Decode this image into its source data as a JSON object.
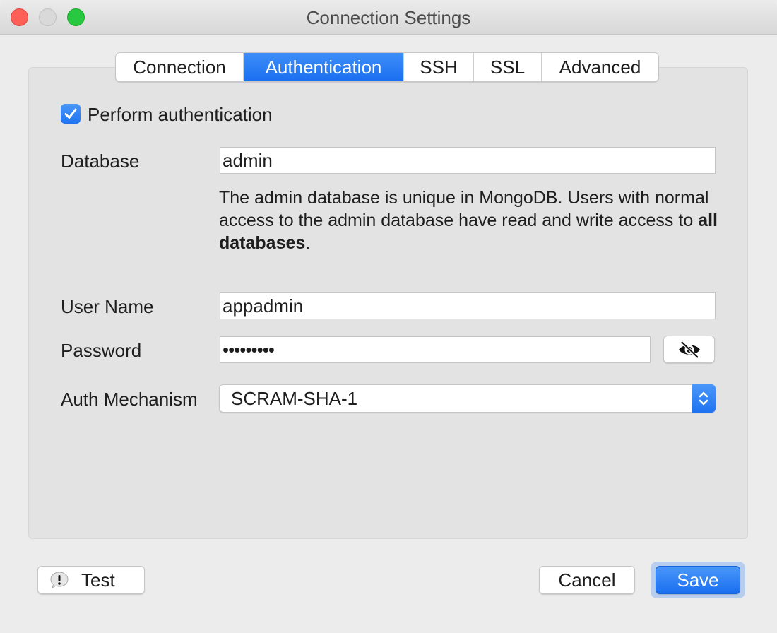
{
  "window": {
    "title": "Connection Settings"
  },
  "tabs": [
    "Connection",
    "Authentication",
    "SSH",
    "SSL",
    "Advanced"
  ],
  "active_tab": "Authentication",
  "auth": {
    "perform_label": "Perform authentication",
    "perform_checked": true,
    "database_label": "Database",
    "database_value": "admin",
    "help_text_1": "The admin database is unique in MongoDB. Users with normal access to the admin database have read and write access to ",
    "help_text_bold": "all databases",
    "help_text_end": ".",
    "username_label": "User Name",
    "username_value": "appadmin",
    "password_label": "Password",
    "password_value": "•••••••••",
    "mechanism_label": "Auth Mechanism",
    "mechanism_value": "SCRAM-SHA-1"
  },
  "icons": {
    "checkbox": "checkmark-icon",
    "show_password": "eye-slash-icon",
    "select": "chevron-up-down-icon",
    "test": "warning-bubble-icon"
  },
  "buttons": {
    "test": "Test",
    "cancel": "Cancel",
    "save": "Save"
  },
  "colors": {
    "accent": "#1a6ff0",
    "panel": "#e3e3e3",
    "window": "#ececec"
  }
}
